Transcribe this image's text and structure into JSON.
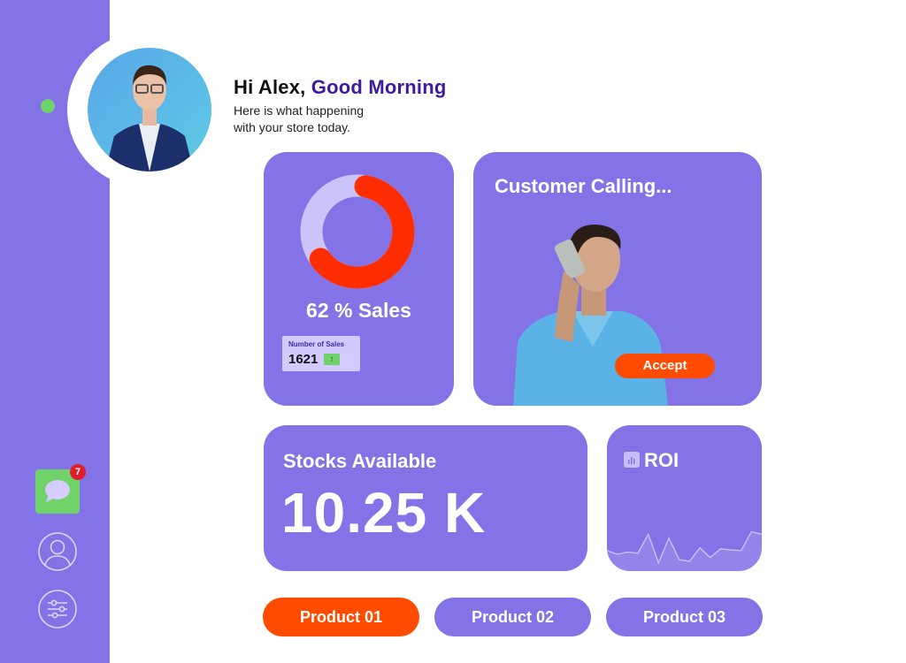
{
  "header": {
    "greeting_name": "Hi Alex,",
    "greeting_time": "Good Morning",
    "subtitle_line1": "Here is what happening",
    "subtitle_line2": "with your store today."
  },
  "sidebar": {
    "status": "online",
    "items": [
      {
        "icon": "message-icon",
        "badge": "7"
      },
      {
        "icon": "profile-icon"
      },
      {
        "icon": "settings-sliders-icon"
      }
    ]
  },
  "sales_card": {
    "percent": 62,
    "label": "62 % Sales",
    "number_title": "Number of Sales",
    "number_value": "1621",
    "trend": "up"
  },
  "call_card": {
    "title": "Customer Calling...",
    "accept_label": "Accept"
  },
  "stock_card": {
    "title": "Stocks Available",
    "value": "10.25 K"
  },
  "roi_card": {
    "title": "ROI",
    "sparkline": [
      0.25,
      0.18,
      0.22,
      0.2,
      0.55,
      0.02,
      0.48,
      0.08,
      0.05,
      0.3,
      0.12,
      0.28,
      0.26,
      0.25,
      0.6,
      0.55
    ]
  },
  "products": [
    "Product 01",
    "Product 02",
    "Product 03"
  ],
  "colors": {
    "primary": "#8473e6",
    "accent": "#ff4c00",
    "donut_fill": "#ff2d00",
    "donut_track": "#cdc3fb",
    "online": "#6fd36a",
    "greeting_accent": "#3f1a9c"
  }
}
